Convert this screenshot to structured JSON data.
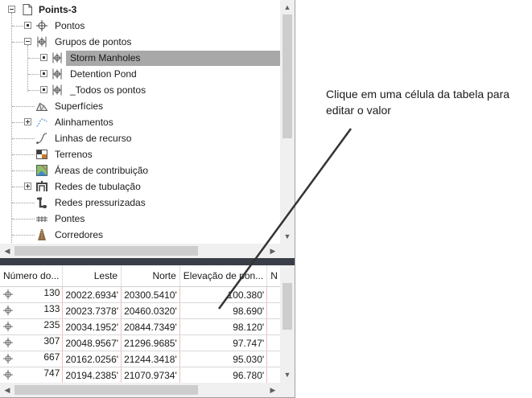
{
  "tree": {
    "root": "Points-3",
    "items": [
      {
        "label": "Pontos",
        "icon": "point-icon",
        "expander": "dot"
      },
      {
        "label": "Grupos de pontos",
        "icon": "point-group-icon",
        "expander": "minus"
      },
      {
        "label": "Storm Manholes",
        "icon": "point-group-icon",
        "expander": "dot",
        "selected": true
      },
      {
        "label": "Detention Pond",
        "icon": "point-group-icon",
        "expander": "dot"
      },
      {
        "label": "_Todos os pontos",
        "icon": "point-group-icon",
        "expander": "dot"
      },
      {
        "label": "Superfícies",
        "icon": "surface-icon",
        "expander": "none"
      },
      {
        "label": "Alinhamentos",
        "icon": "alignment-icon",
        "expander": "plus"
      },
      {
        "label": "Linhas de recurso",
        "icon": "feature-line-icon",
        "expander": "none"
      },
      {
        "label": "Terrenos",
        "icon": "parcel-icon",
        "expander": "none"
      },
      {
        "label": "Áreas de contribuição",
        "icon": "catchment-icon",
        "expander": "none"
      },
      {
        "label": "Redes de tubulação",
        "icon": "pipe-network-icon",
        "expander": "plus"
      },
      {
        "label": "Redes pressurizadas",
        "icon": "pressure-network-icon",
        "expander": "none"
      },
      {
        "label": "Pontes",
        "icon": "bridge-icon",
        "expander": "none"
      },
      {
        "label": "Corredores",
        "icon": "corridor-icon",
        "expander": "none"
      }
    ]
  },
  "grid": {
    "columns": [
      "Número do...",
      "Leste",
      "Norte",
      "Elevação de pon...",
      "N"
    ],
    "rows": [
      {
        "numero": "130",
        "leste": "20022.6934'",
        "norte": "20300.5410'",
        "elev": "100.380'"
      },
      {
        "numero": "133",
        "leste": "20023.7378'",
        "norte": "20460.0320'",
        "elev": "98.690'"
      },
      {
        "numero": "235",
        "leste": "20034.1952'",
        "norte": "20844.7349'",
        "elev": "98.120'"
      },
      {
        "numero": "307",
        "leste": "20048.9567'",
        "norte": "21296.9685'",
        "elev": "97.747'"
      },
      {
        "numero": "667",
        "leste": "20162.0256'",
        "norte": "21244.3418'",
        "elev": "95.030'"
      },
      {
        "numero": "747",
        "leste": "20194.2385'",
        "norte": "21070.9734'",
        "elev": "96.780'"
      }
    ]
  },
  "callout": {
    "line1": "Clique em uma célula da tabela para",
    "line2": "editar o valor"
  },
  "colors": {
    "selection": "#a8a8a8",
    "splitter": "#3a3f47",
    "leader": "#333333"
  }
}
